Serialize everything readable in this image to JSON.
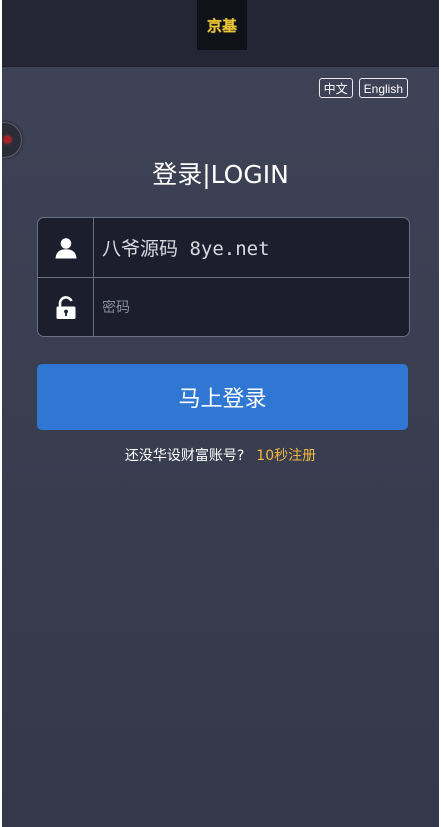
{
  "header": {
    "logo_text": "京基"
  },
  "language": {
    "options": [
      "中文",
      "English"
    ]
  },
  "login": {
    "title": "登录|LOGIN",
    "username_value": "八爷源码 8ye.net",
    "password_placeholder": "密码",
    "submit_label": "马上登录",
    "register_prompt": "还没华设财富账号?",
    "register_link": "10秒注册"
  },
  "icons": {
    "user": "user-icon",
    "lock": "lock-icon"
  },
  "colors": {
    "background": "#3b3f52",
    "topbar": "#242635",
    "logo_gold": "#e8c53a",
    "button_blue": "#3077d4",
    "link_gold": "#f0b73f"
  }
}
